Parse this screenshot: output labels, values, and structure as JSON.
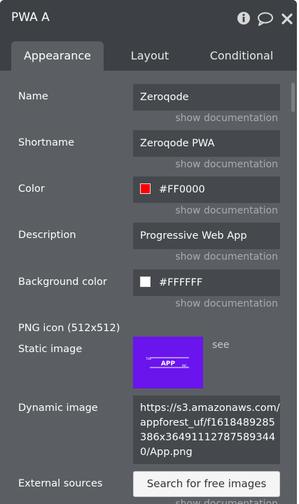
{
  "window": {
    "title": "PWA A"
  },
  "header_icons": [
    "info-icon",
    "comment-icon",
    "close-icon"
  ],
  "tabs": [
    {
      "label": "Appearance",
      "active": true
    },
    {
      "label": "Layout",
      "active": false
    },
    {
      "label": "Conditional",
      "active": false
    }
  ],
  "fields": {
    "name": {
      "label": "Name",
      "value": "Zeroqode"
    },
    "shortname": {
      "label": "Shortname",
      "value": "Zeroqode PWA"
    },
    "color": {
      "label": "Color",
      "value": "#FF0000",
      "swatch": "#FF0000"
    },
    "description": {
      "label": "Description",
      "value": "Progressive Web App"
    },
    "background_color": {
      "label": "Background color",
      "value": "#FFFFFF",
      "swatch": "#FFFFFF"
    }
  },
  "doc_link": "show documentation",
  "png_icon": {
    "heading": "PNG icon (512x512)",
    "static_label": "Static image",
    "static_image": {
      "fill": "#6A14EE",
      "small_left": "THE",
      "main": "APP",
      "small_right": "INC."
    },
    "see_label": "see",
    "dynamic_label": "Dynamic image",
    "dynamic_value": "https://s3.amazonaws.com/appforest_uf/f1618489285386x364911127875893440/App.png"
  },
  "external": {
    "label": "External sources",
    "button": "Search for free images"
  }
}
